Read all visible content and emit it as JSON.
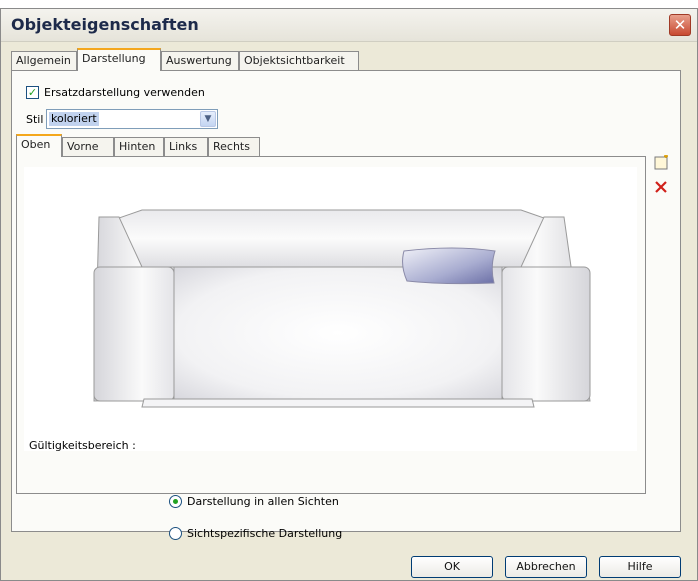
{
  "window": {
    "title": "Objekteigenschaften",
    "close_icon": "close-icon"
  },
  "tabs": [
    {
      "label": "Allgemein",
      "active": false
    },
    {
      "label": "Darstellung",
      "active": true
    },
    {
      "label": "Auswertung",
      "active": false
    },
    {
      "label": "Objektsichtbarkeit",
      "active": false
    }
  ],
  "substitute": {
    "label": "Ersatzdarstellung verwenden",
    "checked": true
  },
  "style": {
    "label": "Stil",
    "value": "koloriert"
  },
  "view_tabs": [
    {
      "label": "Oben",
      "active": true
    },
    {
      "label": "Vorne",
      "active": false
    },
    {
      "label": "Hinten",
      "active": false
    },
    {
      "label": "Links",
      "active": false
    },
    {
      "label": "Rechts",
      "active": false
    }
  ],
  "side_tools": [
    "new-icon",
    "delete-icon"
  ],
  "validity": {
    "label": "Gültigkeitsbereich :",
    "options": [
      {
        "label": "Darstellung in allen Sichten",
        "selected": true
      },
      {
        "label": "Sichtspezifische Darstellung",
        "selected": false
      }
    ]
  },
  "buttons": {
    "ok": "OK",
    "cancel": "Abbrechen",
    "help": "Hilfe"
  }
}
